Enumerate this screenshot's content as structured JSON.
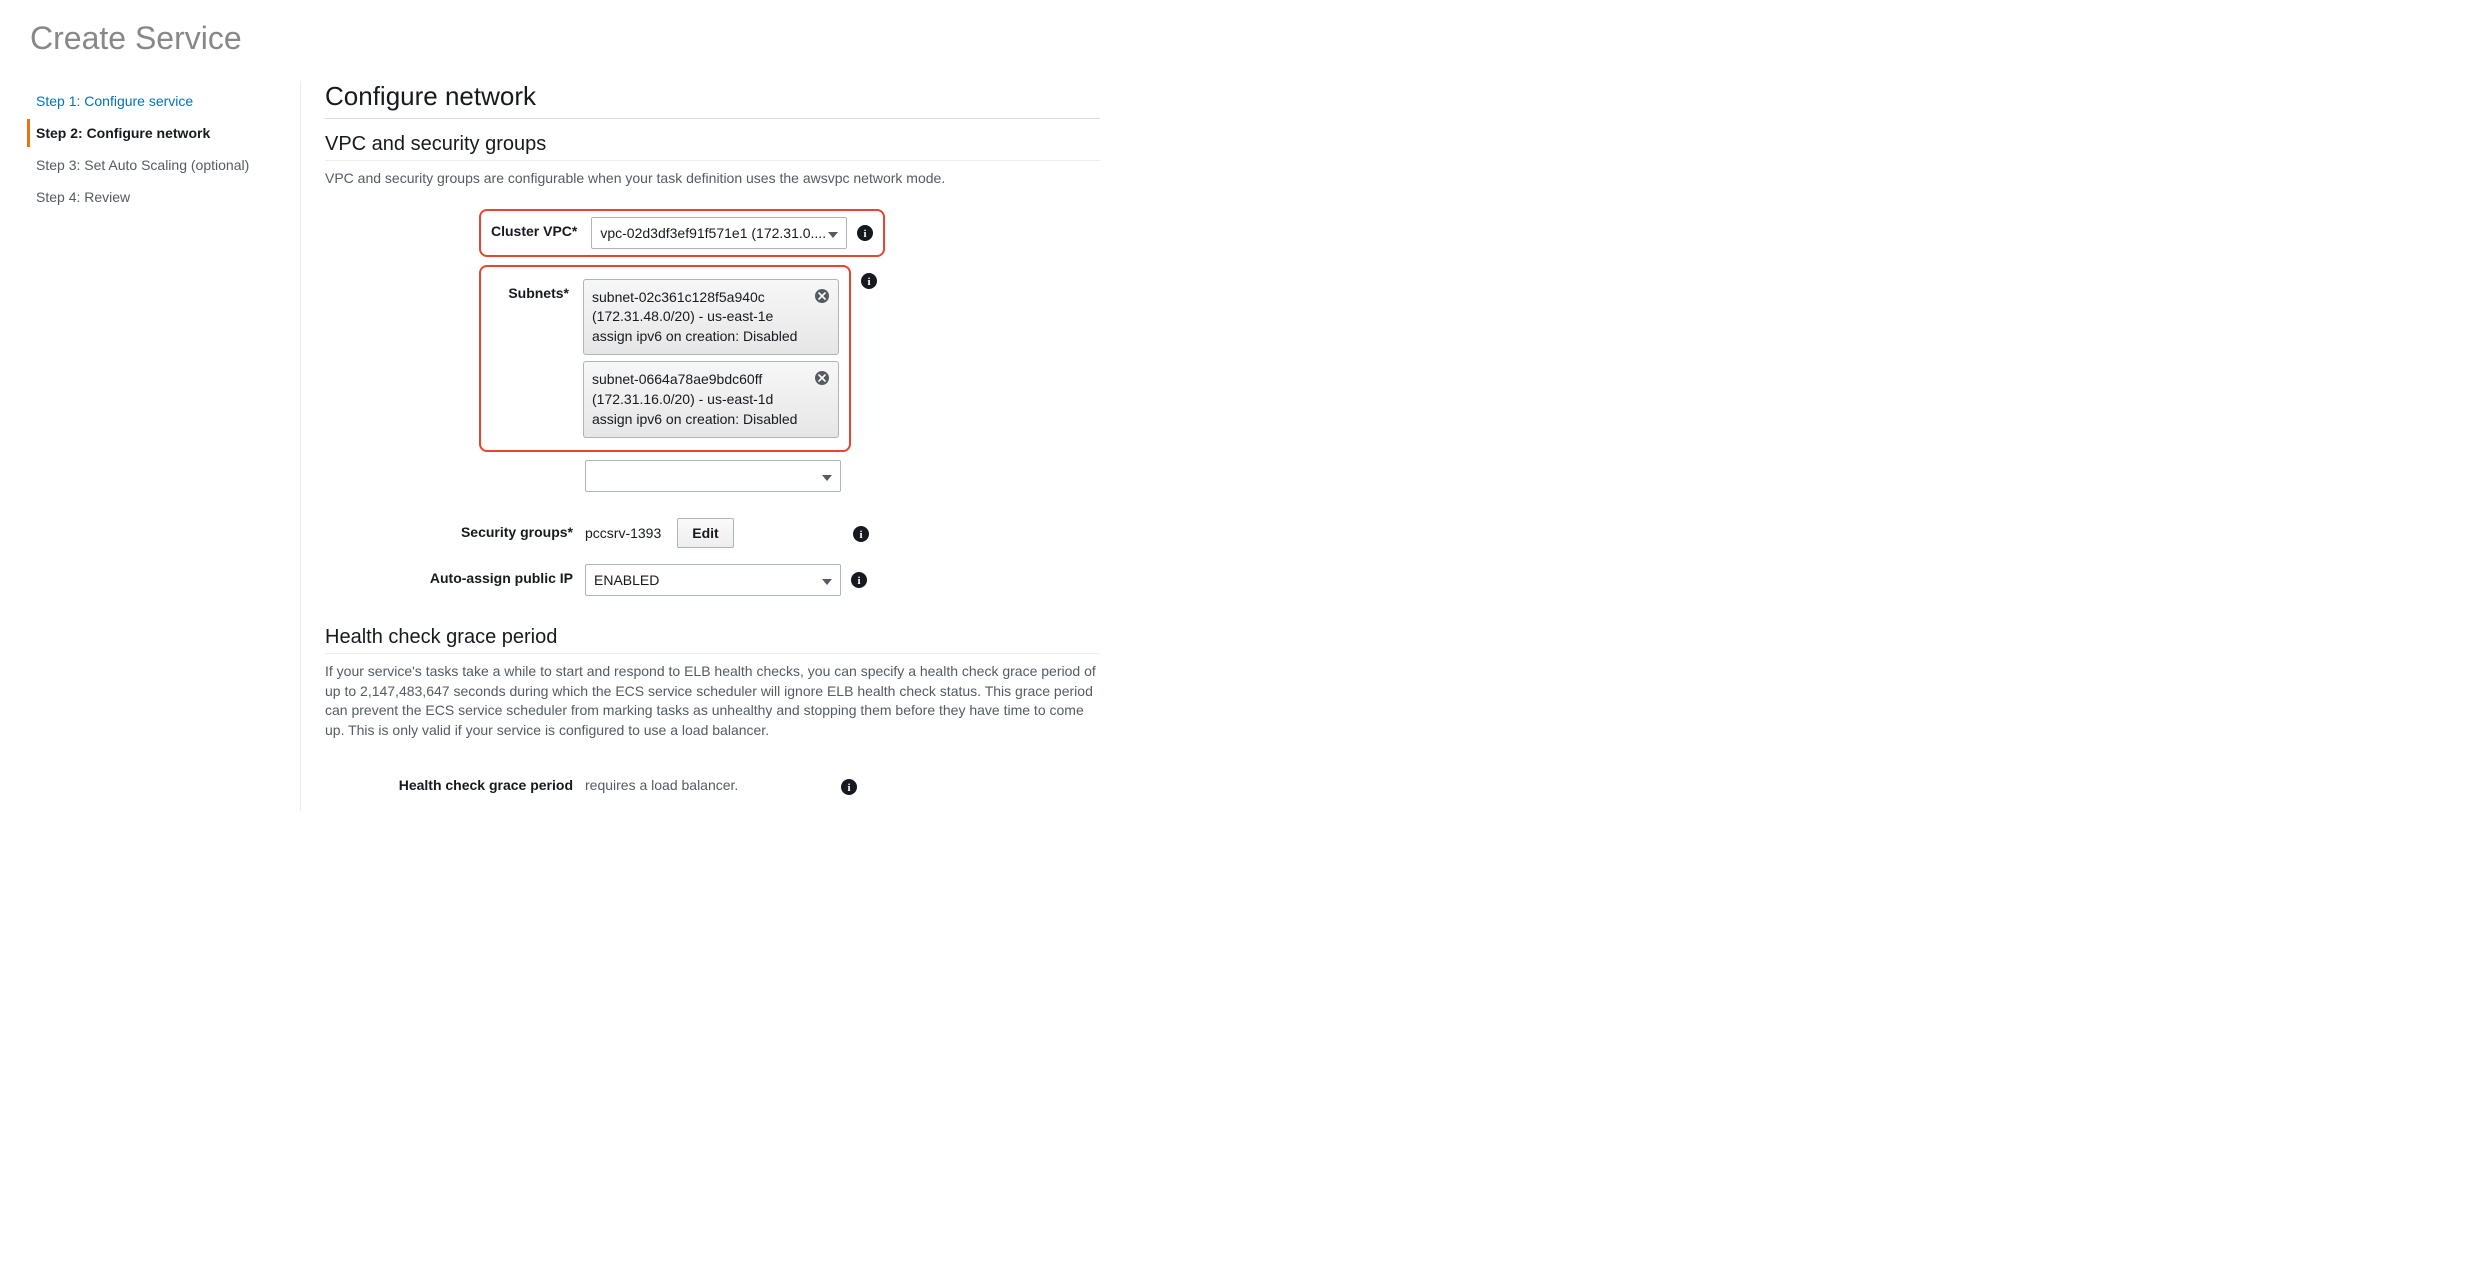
{
  "page_title": "Create Service",
  "sidebar": {
    "items": [
      {
        "label": "Step 1: Configure service"
      },
      {
        "label": "Step 2: Configure network"
      },
      {
        "label": "Step 3: Set Auto Scaling (optional)"
      },
      {
        "label": "Step 4: Review"
      }
    ]
  },
  "main": {
    "heading": "Configure network",
    "section_vpc": {
      "title": "VPC and security groups",
      "description": "VPC and security groups are configurable when your task definition uses the awsvpc network mode.",
      "fields": {
        "cluster_vpc": {
          "label": "Cluster VPC*",
          "value": "vpc-02d3df3ef91f571e1 (172.31.0...."
        },
        "subnets": {
          "label": "Subnets*",
          "chips": [
            {
              "id": "subnet-02c361c128f5a940c",
              "cidr_az": "(172.31.48.0/20) - us-east-1e",
              "ipv6": "assign ipv6 on creation: Disabled"
            },
            {
              "id": "subnet-0664a78ae9bdc60ff",
              "cidr_az": "(172.31.16.0/20) - us-east-1d",
              "ipv6": "assign ipv6 on creation: Disabled"
            }
          ]
        },
        "security_groups": {
          "label": "Security groups*",
          "value": "pccsrv-1393",
          "edit_label": "Edit"
        },
        "auto_assign_ip": {
          "label": "Auto-assign public IP",
          "value": "ENABLED"
        }
      }
    },
    "section_health": {
      "title": "Health check grace period",
      "description": "If your service's tasks take a while to start and respond to ELB health checks, you can specify a health check grace period of up to 2,147,483,647 seconds during which the ECS service scheduler will ignore ELB health check status. This grace period can prevent the ECS service scheduler from marking tasks as unhealthy and stopping them before they have time to come up. This is only valid if your service is configured to use a load balancer.",
      "field": {
        "label": "Health check grace period",
        "value": "requires a load balancer."
      }
    }
  }
}
